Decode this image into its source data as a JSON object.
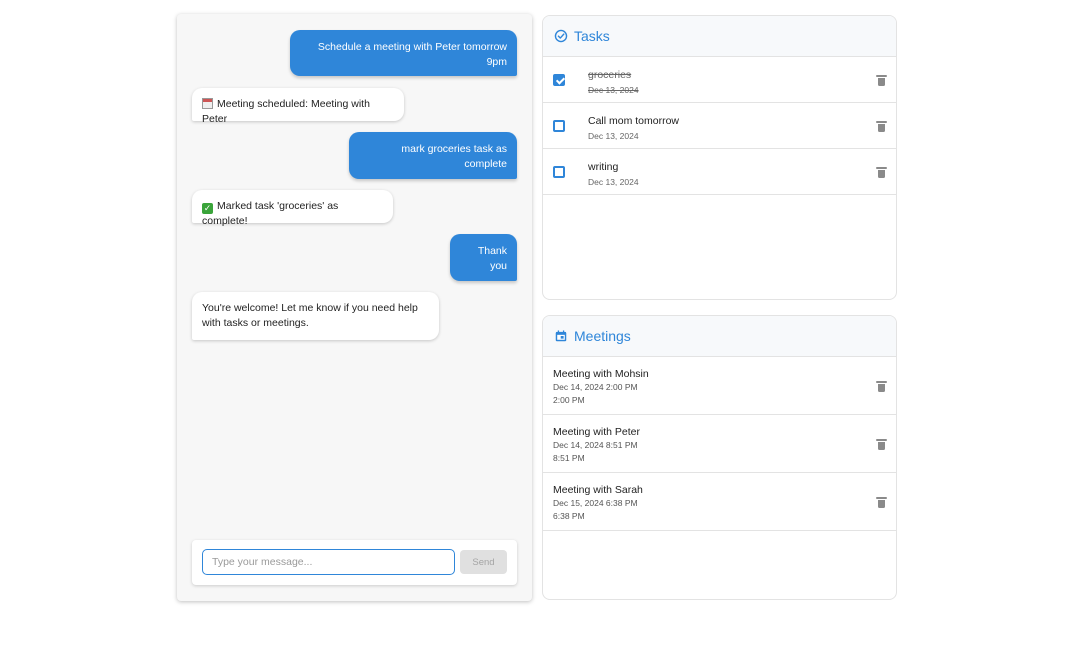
{
  "chat": {
    "messages": [
      {
        "role": "user",
        "text": "Schedule a meeting with Peter tomorrow 9pm"
      },
      {
        "role": "bot",
        "text": "Meeting scheduled: Meeting with Peter",
        "icon": "calendar-emoji"
      },
      {
        "role": "user",
        "text": "mark groceries task as complete"
      },
      {
        "role": "bot",
        "text": "Marked task 'groceries' as complete!",
        "icon": "check-mark-emoji"
      },
      {
        "role": "user",
        "text": "Thank you"
      },
      {
        "role": "bot",
        "text": "You're welcome! Let me know if you need help with tasks or meetings."
      }
    ],
    "input": {
      "value": "",
      "placeholder": "Type your message..."
    },
    "send_label": "Send"
  },
  "tasks": {
    "title": "Tasks",
    "icon": "check-circle-icon",
    "items": [
      {
        "name": "groceries",
        "date": "Dec 13, 2024",
        "completed": true
      },
      {
        "name": "Call mom tomorrow",
        "date": "Dec 13, 2024",
        "completed": false
      },
      {
        "name": "writing",
        "date": "Dec 13, 2024",
        "completed": false
      }
    ]
  },
  "meetings": {
    "title": "Meetings",
    "icon": "calendar-icon",
    "items": [
      {
        "title": "Meeting with Mohsin",
        "datetime": "Dec 14, 2024 2:00 PM",
        "time": "2:00 PM"
      },
      {
        "title": "Meeting with Peter",
        "datetime": "Dec 14, 2024 8:51 PM",
        "time": "8:51 PM"
      },
      {
        "title": "Meeting with Sarah",
        "datetime": "Dec 15, 2024 6:38 PM",
        "time": "6:38 PM"
      }
    ]
  },
  "colors": {
    "accent": "#2f86d9",
    "icon_gray": "#8a8a8a"
  }
}
